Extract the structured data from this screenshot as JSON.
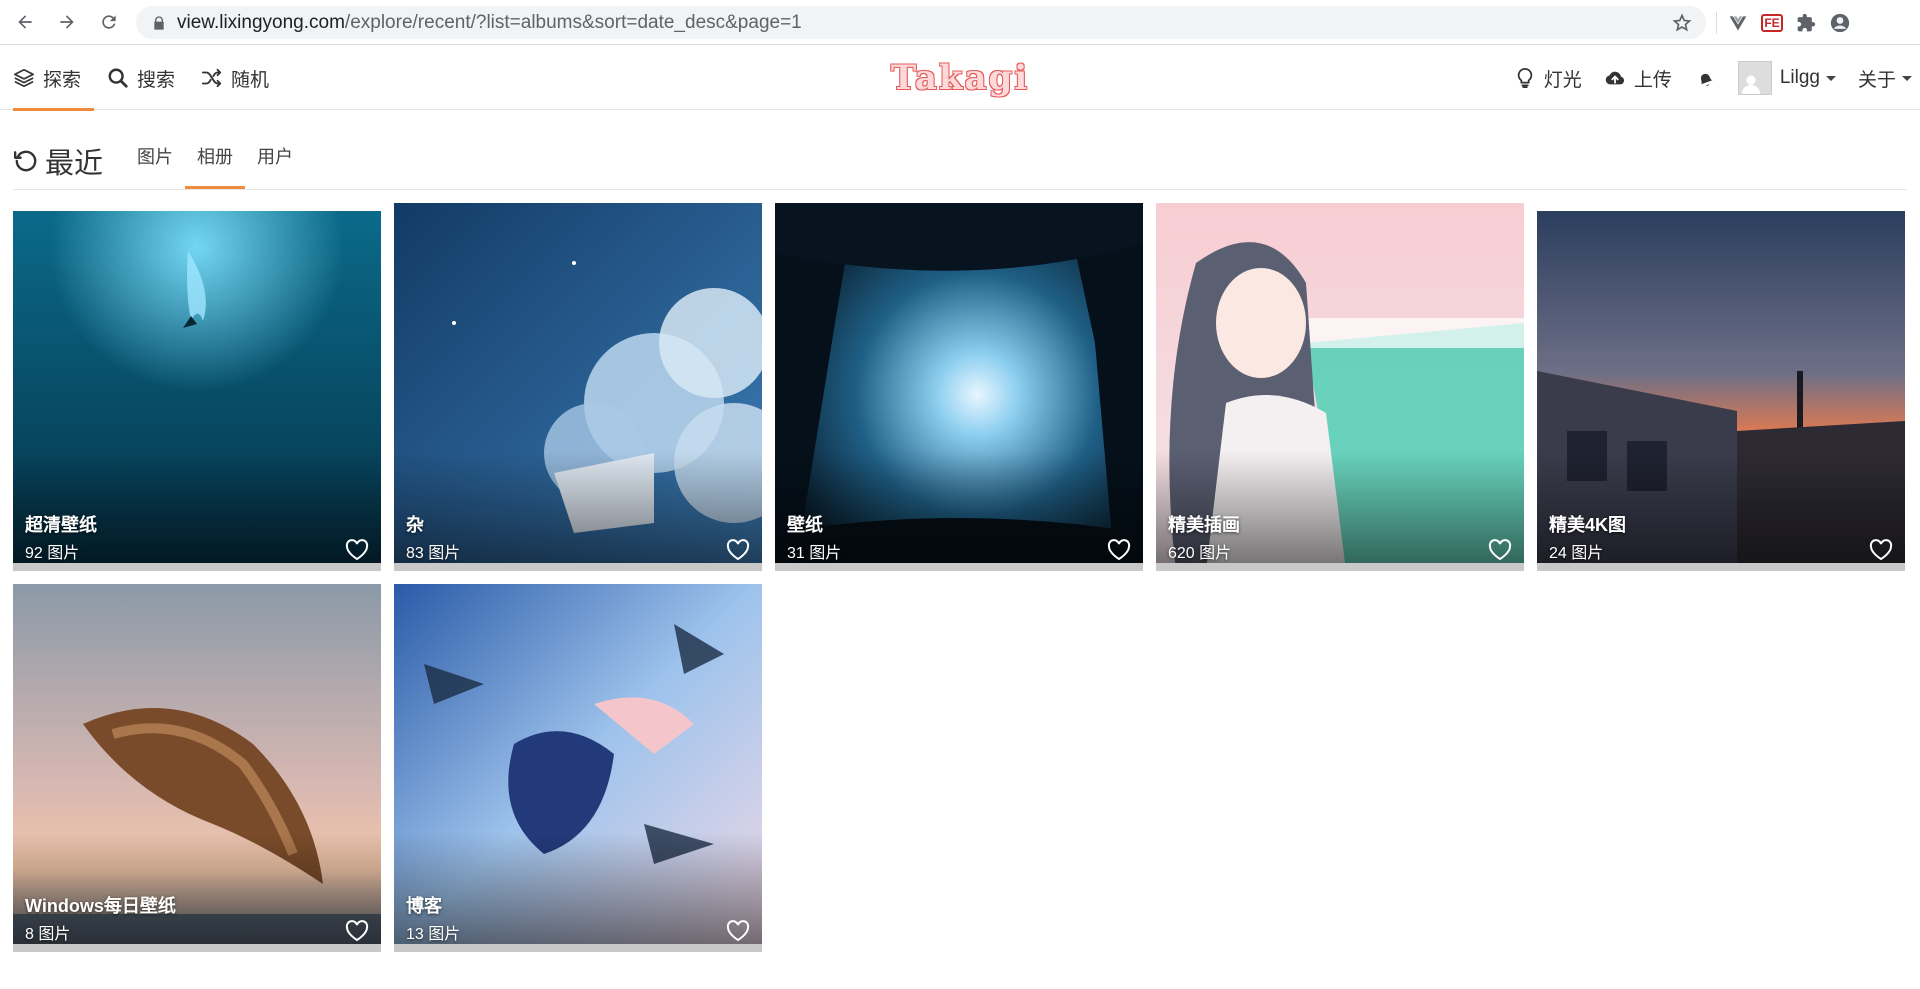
{
  "browser": {
    "url_host": "view.lixingyong.com",
    "url_path": "/explore/recent/?list=albums&sort=date_desc&page=1"
  },
  "site": {
    "brand": "Takagi",
    "nav": [
      {
        "label": "探索",
        "icon": "layers-icon"
      },
      {
        "label": "搜索",
        "icon": "search-icon"
      },
      {
        "label": "随机",
        "icon": "shuffle-icon"
      }
    ],
    "right": {
      "light": "灯光",
      "upload": "上传",
      "user": "Lilgg",
      "about": "关于"
    }
  },
  "section": {
    "title": "最近",
    "tabs": [
      "图片",
      "相册",
      "用户"
    ],
    "active_tab": "相册"
  },
  "albums": [
    {
      "name": "超清壁纸",
      "count": "92 图片",
      "theme": "ocean"
    },
    {
      "name": "杂",
      "count": "83 图片",
      "theme": "sky"
    },
    {
      "name": "壁纸",
      "count": "31 图片",
      "theme": "moon"
    },
    {
      "name": "精美插画",
      "count": "620 图片",
      "theme": "sakura"
    },
    {
      "name": "精美4K图",
      "count": "24 图片",
      "theme": "sunset-train"
    },
    {
      "name": "Windows每日壁纸",
      "count": "8 图片",
      "theme": "whale"
    },
    {
      "name": "博客",
      "count": "13 图片",
      "theme": "flying-girl"
    }
  ],
  "colors": {
    "accent": "#f08a3c",
    "brand_text": "#e25c5c"
  }
}
